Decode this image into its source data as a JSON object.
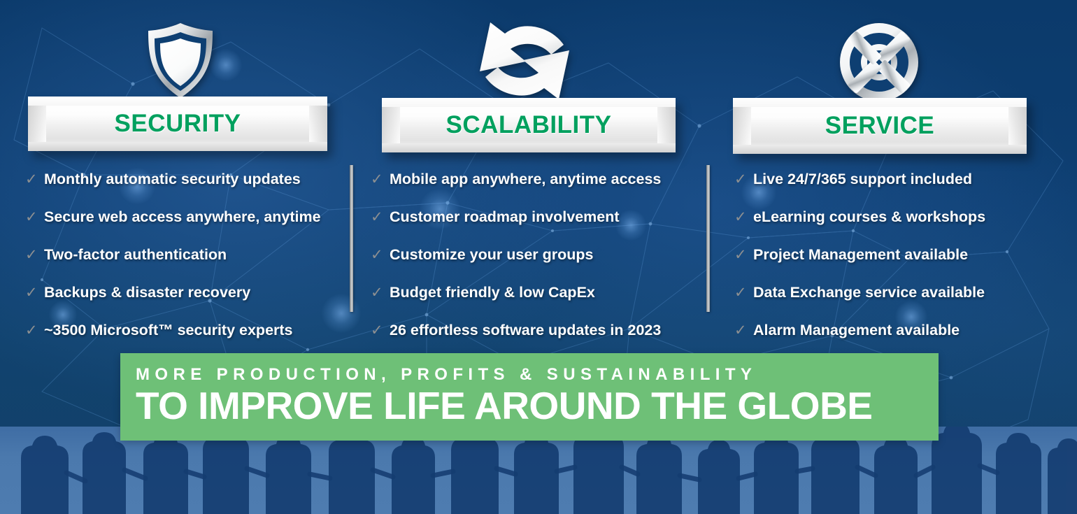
{
  "meta": {
    "background_color": "#0b3a6b",
    "accent_green": "#00a05e",
    "banner_green": "#6ec077",
    "plaque_color": "#efefef",
    "text_color": "#ffffff",
    "check_color": "#8c8f91"
  },
  "columns": [
    {
      "id": "security",
      "icon": "shield-icon",
      "title": "SECURITY",
      "features": [
        "Monthly automatic security updates",
        "Secure web access anywhere, anytime",
        "Two-factor authentication",
        "Backups & disaster recovery",
        "~3500 Microsoft™ security experts"
      ]
    },
    {
      "id": "scalability",
      "icon": "sync-arrows-icon",
      "title": "SCALABILITY",
      "features": [
        "Mobile app anywhere, anytime access",
        "Customer roadmap involvement",
        "Customize your user groups",
        "Budget friendly & low CapEx",
        "26 effortless software updates in 2023"
      ]
    },
    {
      "id": "service",
      "icon": "lifebuoy-icon",
      "title": "SERVICE",
      "features": [
        "Live 24/7/365 support included",
        "eLearning courses & workshops",
        "Project Management available",
        "Data Exchange service available",
        "Alarm Management available"
      ]
    }
  ],
  "check_glyph": "✓",
  "banner": {
    "line1": "MORE PRODUCTION, PROFITS & SUSTAINABILITY",
    "line2": "TO IMPROVE LIFE AROUND THE GLOBE"
  }
}
